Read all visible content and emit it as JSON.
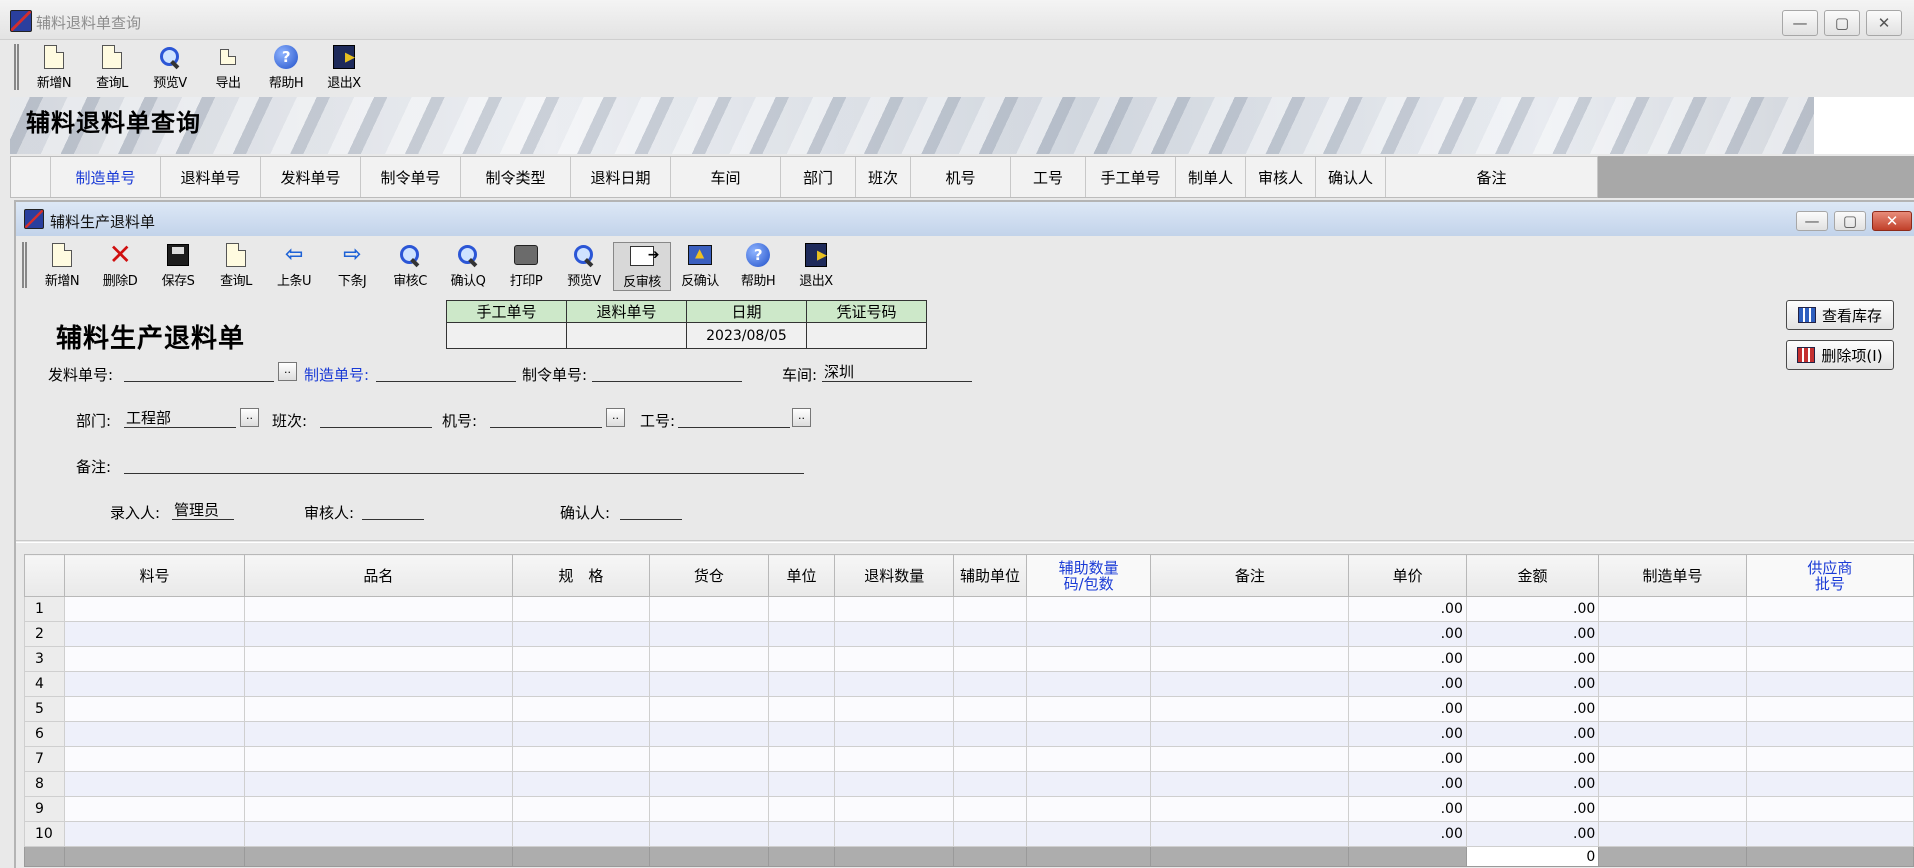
{
  "outer_window": {
    "title": "辅料退料单查询",
    "toolbar": [
      {
        "label": "新增N",
        "icon": "new-doc-icon"
      },
      {
        "label": "查询L",
        "icon": "query-doc-icon"
      },
      {
        "label": "预览V",
        "icon": "preview-magnifier-icon"
      },
      {
        "label": "导出",
        "icon": "export-icon"
      },
      {
        "label": "帮助H",
        "icon": "help-icon"
      },
      {
        "label": "退出X",
        "icon": "exit-icon"
      }
    ],
    "banner_title": "辅料退料单查询",
    "query_columns": [
      "制造单号",
      "退料单号",
      "发料单号",
      "制令单号",
      "制令类型",
      "退料日期",
      "车间",
      "部门",
      "班次",
      "机号",
      "工号",
      "手工单号",
      "制单人",
      "审核人",
      "确认人",
      "备注"
    ]
  },
  "child_window": {
    "title": "辅料生产退料单",
    "toolbar": [
      {
        "label": "新增N",
        "icon": "new-doc-icon"
      },
      {
        "label": "删除D",
        "icon": "delete-x-icon"
      },
      {
        "label": "保存S",
        "icon": "save-disk-icon"
      },
      {
        "label": "查询L",
        "icon": "query-doc-icon"
      },
      {
        "label": "上条U",
        "icon": "arrow-left-icon"
      },
      {
        "label": "下条J",
        "icon": "arrow-right-icon"
      },
      {
        "label": "审核C",
        "icon": "audit-magnifier-icon"
      },
      {
        "label": "确认Q",
        "icon": "confirm-magnifier-icon"
      },
      {
        "label": "打印P",
        "icon": "printer-icon"
      },
      {
        "label": "预览V",
        "icon": "preview-magnifier-icon"
      },
      {
        "label": "反审核",
        "icon": "unaudit-icon"
      },
      {
        "label": "反确认",
        "icon": "unconfirm-icon"
      },
      {
        "label": "帮助H",
        "icon": "help-icon"
      },
      {
        "label": "退出X",
        "icon": "exit-icon"
      }
    ],
    "form_title": "辅料生产退料单",
    "doc_table": {
      "headers": [
        "手工单号",
        "退料单号",
        "日期",
        "凭证号码"
      ],
      "values": [
        "",
        "",
        "2023/08/05",
        ""
      ]
    },
    "buttons": {
      "view_stock": "查看库存",
      "delete_item": "删除项(I)"
    },
    "fields": {
      "issue_no_label": "发料单号:",
      "issue_no": "",
      "mfg_no_label": "制造单号:",
      "mfg_no": "",
      "order_no_label": "制令单号:",
      "order_no": "",
      "workshop_label": "车间:",
      "workshop": "深圳",
      "dept_label": "部门:",
      "dept": "工程部",
      "shift_label": "班次:",
      "shift": "",
      "machine_label": "机号:",
      "machine": "",
      "worker_label": "工号:",
      "worker": "",
      "remark_label": "备注:",
      "remark": "",
      "entered_by_label": "录入人:",
      "entered_by": "管理员",
      "auditor_label": "审核人:",
      "auditor": "",
      "confirmer_label": "确认人:",
      "confirmer": ""
    },
    "grid": {
      "columns": [
        "",
        "料号",
        "品名",
        "规　格",
        "货仓",
        "单位",
        "退料数量",
        "辅助单位",
        "辅助数量\n码/包数",
        "备注",
        "单价",
        "金额",
        "制造单号",
        "供应商\n批号"
      ],
      "rows": [
        {
          "no": "1",
          "price": ".00",
          "amount": ".00"
        },
        {
          "no": "2",
          "price": ".00",
          "amount": ".00"
        },
        {
          "no": "3",
          "price": ".00",
          "amount": ".00"
        },
        {
          "no": "4",
          "price": ".00",
          "amount": ".00"
        },
        {
          "no": "5",
          "price": ".00",
          "amount": ".00"
        },
        {
          "no": "6",
          "price": ".00",
          "amount": ".00"
        },
        {
          "no": "7",
          "price": ".00",
          "amount": ".00"
        },
        {
          "no": "8",
          "price": ".00",
          "amount": ".00"
        },
        {
          "no": "9",
          "price": ".00",
          "amount": ".00"
        },
        {
          "no": "10",
          "price": ".00",
          "amount": ".00"
        }
      ],
      "total_amount": "0"
    }
  },
  "window_controls": {
    "minimize": "—",
    "maximize": "▢",
    "close": "✕"
  },
  "colors": {
    "accent_blue": "#1a3bd6",
    "doc_header_green": "#cde8c9",
    "grid_stripe": "#eef0fa"
  }
}
